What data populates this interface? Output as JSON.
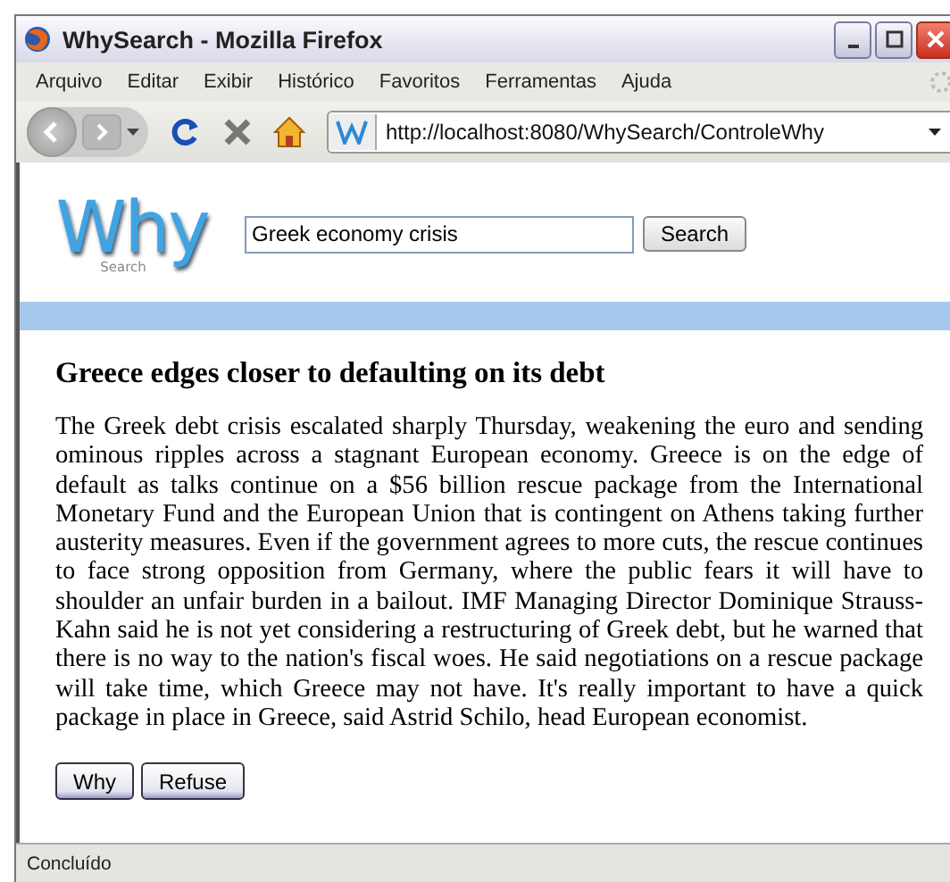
{
  "window": {
    "title": "WhySearch - Mozilla Firefox"
  },
  "menu": [
    "Arquivo",
    "Editar",
    "Exibir",
    "Histórico",
    "Favoritos",
    "Ferramentas",
    "Ajuda"
  ],
  "address_bar": {
    "value": "http://localhost:8080/WhySearch/ControleWhy"
  },
  "site": {
    "logo": "Why",
    "logo_sub": "Search",
    "search": {
      "value": "Greek economy crisis",
      "button": "Search"
    }
  },
  "article": {
    "title": "Greece edges closer to defaulting on its debt",
    "body": "The Greek debt crisis escalated sharply Thursday, weakening the euro and sending ominous ripples across a stagnant European economy. Greece is on the edge of default as talks continue on a $56 billion rescue package from the International Monetary Fund and the European Union that is contingent on Athens taking further austerity measures. Even if the government agrees to more cuts, the rescue continues to face strong opposition from Germany, where the public fears it will have to shoulder an unfair burden in a bailout. IMF Managing Director Dominique Strauss-Kahn said he is not yet considering a restructuring of Greek debt, but he warned that there is no way to the nation's fiscal woes. He said negotiations on a rescue package will take time, which Greece may not have. It's really important to have a quick package in place in Greece, said Astrid Schilo, head European economist.",
    "buttons": [
      "Why",
      "Refuse"
    ]
  },
  "status_bar": "Concluído"
}
